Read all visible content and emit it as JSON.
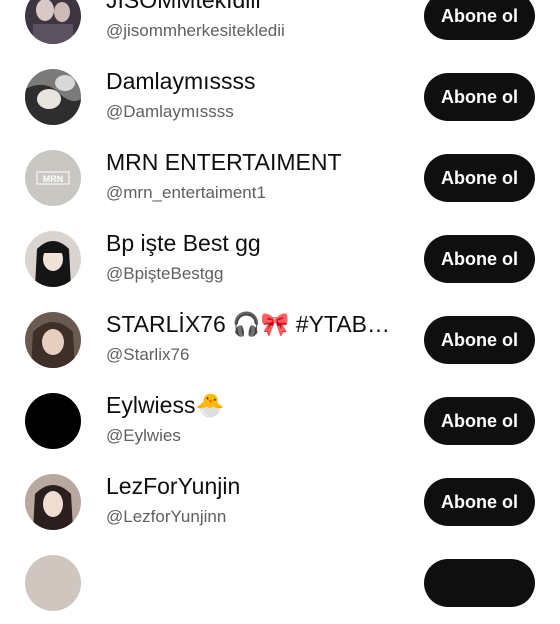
{
  "channels": [
    {
      "name": "JISOMMtekIdiii",
      "handle": "@jisommherkesitekledii",
      "button": "Abone ol",
      "avatar_color": "#3d3540"
    },
    {
      "name": "Damlaymıssss",
      "handle": "@Damlaymıssss",
      "button": "Abone ol",
      "avatar_color": "#4a4a4a"
    },
    {
      "name": "MRN ENTERTAIMENT",
      "handle": "@mrn_entertaiment1",
      "button": "Abone ol",
      "avatar_color": "#c9c7c2",
      "avatar_text": "MRN"
    },
    {
      "name": "Bp işte Best gg",
      "handle": "@BpişteBestgg",
      "button": "Abone ol",
      "avatar_color": "#2a2a2a"
    },
    {
      "name": "STARLİX76 🎧🎀 #YTAB…",
      "handle": "@Starlix76",
      "button": "Abone ol",
      "avatar_color": "#8a7668"
    },
    {
      "name": "Eylwiess🐣",
      "handle": "@Eylwies",
      "button": "Abone ol",
      "avatar_color": "#000000"
    },
    {
      "name": "LezForYunjin",
      "handle": "@LezforYunjinn",
      "button": "Abone ol",
      "avatar_color": "#5a4a48"
    }
  ]
}
